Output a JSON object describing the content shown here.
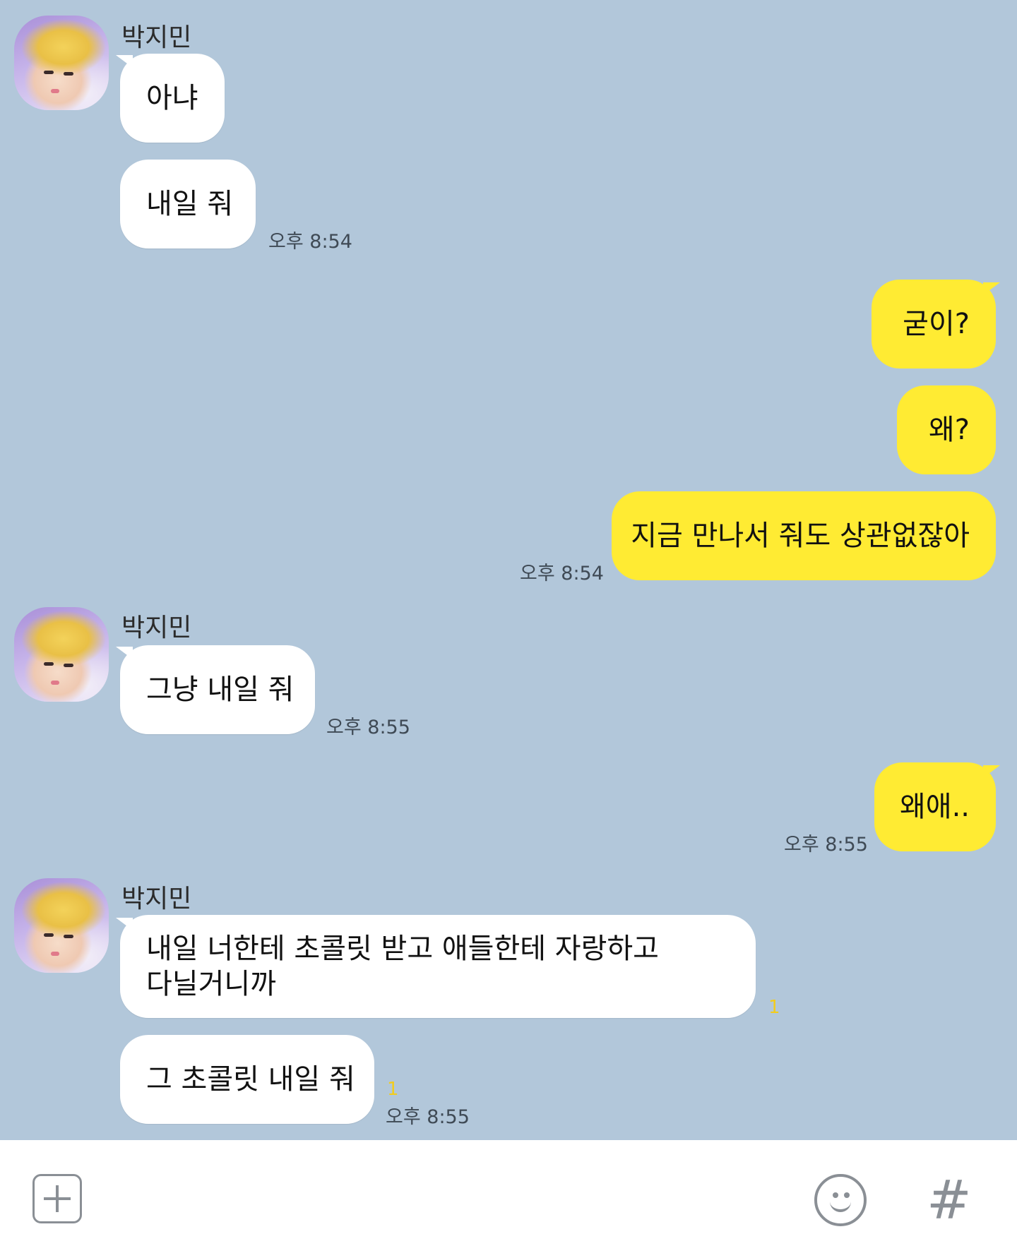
{
  "messages": {
    "m1_sender": "박지민",
    "m1_text": "아냐",
    "m2_text": "내일 줘",
    "m2_time": "오후 8:54",
    "m3_text": "굳이?",
    "m4_text": "왜?",
    "m5_text": "지금 만나서 줘도 상관없잖아",
    "m5_time": "오후 8:54",
    "m6_sender": "박지민",
    "m6_text": "그냥 내일 줘",
    "m6_time": "오후 8:55",
    "m7_text": "왜애..",
    "m7_time": "오후 8:55",
    "m8_sender": "박지민",
    "m8_line1": "내일 너한테 초콜릿 받고 애들한테 자랑하고",
    "m8_line2": "다닐거니까",
    "m8_unread": "1",
    "m9_text": "그 초콜릿 내일 줘",
    "m9_unread": "1",
    "m9_time": "오후 8:55"
  },
  "input_bar": {
    "left_icon": "plus-square-icon",
    "emoji_icon": "smiley-icon",
    "hash_icon": "hash-icon",
    "hash_glyph": "#"
  },
  "colors": {
    "background": "#b2c7da",
    "my_bubble": "#ffeb33",
    "their_bubble": "#ffffff",
    "unread": "#f2cc1e"
  }
}
